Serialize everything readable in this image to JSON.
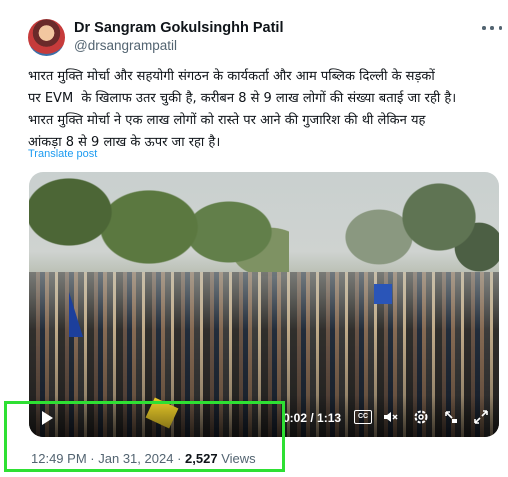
{
  "author": {
    "name": "Dr Sangram Gokulsinghh Patil",
    "handle": "@drsangrampatil"
  },
  "menu": {
    "icon": "more-horizontal-icon"
  },
  "post": {
    "text": "भारत मुक्ति मोर्चा और सहयोगी संगठन के कार्यकर्ता और आम पब्लिक दिल्ली के सड़कों\nपर EVM  के खिलाफ उतर चुकी है, करीबन 8 से 9 लाख लोगों की संख्या बताई जा रही है।\nभारत मुक्ति मोर्चा ने एक लाख लोगों को रास्ते पर आने की गुजारिश की थी लेकिन यह\nआंकड़ा 8 से 9 लाख के ऊपर जा रहा है।",
    "translate_label": "Translate post"
  },
  "video": {
    "time_display": "0:02 / 1:13",
    "cc_label": "CC",
    "icons": [
      "play-icon",
      "captions-icon",
      "mute-icon",
      "settings-icon",
      "picture-in-picture-icon",
      "fullscreen-icon"
    ]
  },
  "meta": {
    "time": "12:49 PM",
    "separator": "·",
    "date": "Jan 31, 2024",
    "views_count": "2,527",
    "views_label": "Views"
  },
  "highlight_color": "#2ee033",
  "link_color": "#1d9bf0"
}
